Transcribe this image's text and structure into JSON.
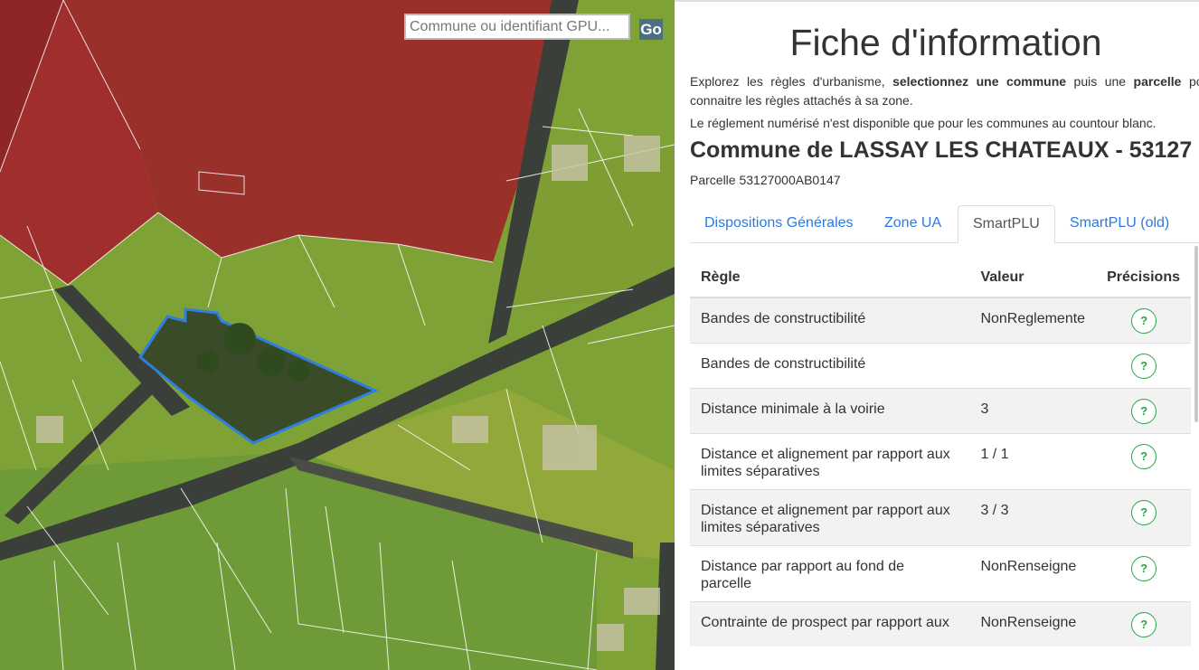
{
  "map": {
    "search_placeholder": "Commune ou identifiant GPU...",
    "go_label": "Go"
  },
  "panel": {
    "title": "Fiche d'information",
    "intro_part1": "Explorez les règles d'urbanisme, ",
    "intro_bold1": "selectionnez une commune",
    "intro_part2": " puis une ",
    "intro_bold2": "parcelle",
    "intro_part3": " pour connaitre les règles attachés à sa zone.",
    "note": "Le réglement numérisé n'est disponible que pour les communes au countour blanc.",
    "commune": "Commune de LASSAY LES CHATEAUX - 53127",
    "parcelle": "Parcelle 53127000AB0147",
    "tabs": [
      {
        "label": "Dispositions Générales"
      },
      {
        "label": "Zone UA"
      },
      {
        "label": "SmartPLU"
      },
      {
        "label": "SmartPLU (old)"
      }
    ],
    "table": {
      "headers": [
        "Règle",
        "Valeur",
        "Précisions"
      ],
      "button_label": "?",
      "rows": [
        {
          "regle": "Bandes de constructibilité",
          "valeur": "NonReglemente"
        },
        {
          "regle": "Bandes de constructibilité",
          "valeur": ""
        },
        {
          "regle": "Distance minimale à la voirie",
          "valeur": "3"
        },
        {
          "regle": "Distance et alignement par rapport aux limites séparatives",
          "valeur": "1 / 1"
        },
        {
          "regle": "Distance et alignement par rapport aux limites séparatives",
          "valeur": "3 / 3"
        },
        {
          "regle": "Distance par rapport au fond de parcelle",
          "valeur": "NonRenseigne"
        },
        {
          "regle": "Contrainte de prospect par rapport aux",
          "valeur": "NonRenseigne"
        }
      ]
    }
  },
  "colors": {
    "zone_red": "#9b2a2a",
    "zone_green": "#8aa82e",
    "parcel_outline": "#2f7fe0",
    "link": "#2a7ae2",
    "help_button": "#28a745"
  }
}
